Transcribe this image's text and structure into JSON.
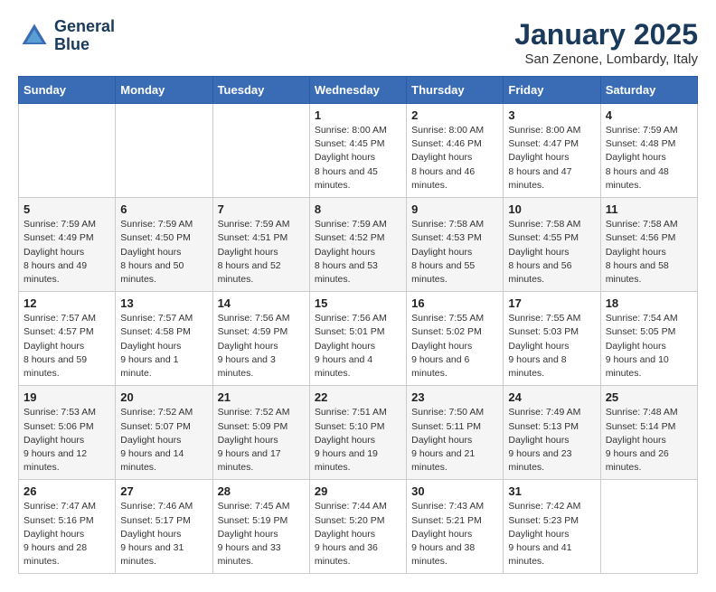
{
  "header": {
    "logo_line1": "General",
    "logo_line2": "Blue",
    "month": "January 2025",
    "location": "San Zenone, Lombardy, Italy"
  },
  "weekdays": [
    "Sunday",
    "Monday",
    "Tuesday",
    "Wednesday",
    "Thursday",
    "Friday",
    "Saturday"
  ],
  "weeks": [
    [
      {
        "day": null
      },
      {
        "day": null
      },
      {
        "day": null
      },
      {
        "day": "1",
        "sunrise": "8:00 AM",
        "sunset": "4:45 PM",
        "daylight": "8 hours and 45 minutes."
      },
      {
        "day": "2",
        "sunrise": "8:00 AM",
        "sunset": "4:46 PM",
        "daylight": "8 hours and 46 minutes."
      },
      {
        "day": "3",
        "sunrise": "8:00 AM",
        "sunset": "4:47 PM",
        "daylight": "8 hours and 47 minutes."
      },
      {
        "day": "4",
        "sunrise": "7:59 AM",
        "sunset": "4:48 PM",
        "daylight": "8 hours and 48 minutes."
      }
    ],
    [
      {
        "day": "5",
        "sunrise": "7:59 AM",
        "sunset": "4:49 PM",
        "daylight": "8 hours and 49 minutes."
      },
      {
        "day": "6",
        "sunrise": "7:59 AM",
        "sunset": "4:50 PM",
        "daylight": "8 hours and 50 minutes."
      },
      {
        "day": "7",
        "sunrise": "7:59 AM",
        "sunset": "4:51 PM",
        "daylight": "8 hours and 52 minutes."
      },
      {
        "day": "8",
        "sunrise": "7:59 AM",
        "sunset": "4:52 PM",
        "daylight": "8 hours and 53 minutes."
      },
      {
        "day": "9",
        "sunrise": "7:58 AM",
        "sunset": "4:53 PM",
        "daylight": "8 hours and 55 minutes."
      },
      {
        "day": "10",
        "sunrise": "7:58 AM",
        "sunset": "4:55 PM",
        "daylight": "8 hours and 56 minutes."
      },
      {
        "day": "11",
        "sunrise": "7:58 AM",
        "sunset": "4:56 PM",
        "daylight": "8 hours and 58 minutes."
      }
    ],
    [
      {
        "day": "12",
        "sunrise": "7:57 AM",
        "sunset": "4:57 PM",
        "daylight": "8 hours and 59 minutes."
      },
      {
        "day": "13",
        "sunrise": "7:57 AM",
        "sunset": "4:58 PM",
        "daylight": "9 hours and 1 minute."
      },
      {
        "day": "14",
        "sunrise": "7:56 AM",
        "sunset": "4:59 PM",
        "daylight": "9 hours and 3 minutes."
      },
      {
        "day": "15",
        "sunrise": "7:56 AM",
        "sunset": "5:01 PM",
        "daylight": "9 hours and 4 minutes."
      },
      {
        "day": "16",
        "sunrise": "7:55 AM",
        "sunset": "5:02 PM",
        "daylight": "9 hours and 6 minutes."
      },
      {
        "day": "17",
        "sunrise": "7:55 AM",
        "sunset": "5:03 PM",
        "daylight": "9 hours and 8 minutes."
      },
      {
        "day": "18",
        "sunrise": "7:54 AM",
        "sunset": "5:05 PM",
        "daylight": "9 hours and 10 minutes."
      }
    ],
    [
      {
        "day": "19",
        "sunrise": "7:53 AM",
        "sunset": "5:06 PM",
        "daylight": "9 hours and 12 minutes."
      },
      {
        "day": "20",
        "sunrise": "7:52 AM",
        "sunset": "5:07 PM",
        "daylight": "9 hours and 14 minutes."
      },
      {
        "day": "21",
        "sunrise": "7:52 AM",
        "sunset": "5:09 PM",
        "daylight": "9 hours and 17 minutes."
      },
      {
        "day": "22",
        "sunrise": "7:51 AM",
        "sunset": "5:10 PM",
        "daylight": "9 hours and 19 minutes."
      },
      {
        "day": "23",
        "sunrise": "7:50 AM",
        "sunset": "5:11 PM",
        "daylight": "9 hours and 21 minutes."
      },
      {
        "day": "24",
        "sunrise": "7:49 AM",
        "sunset": "5:13 PM",
        "daylight": "9 hours and 23 minutes."
      },
      {
        "day": "25",
        "sunrise": "7:48 AM",
        "sunset": "5:14 PM",
        "daylight": "9 hours and 26 minutes."
      }
    ],
    [
      {
        "day": "26",
        "sunrise": "7:47 AM",
        "sunset": "5:16 PM",
        "daylight": "9 hours and 28 minutes."
      },
      {
        "day": "27",
        "sunrise": "7:46 AM",
        "sunset": "5:17 PM",
        "daylight": "9 hours and 31 minutes."
      },
      {
        "day": "28",
        "sunrise": "7:45 AM",
        "sunset": "5:19 PM",
        "daylight": "9 hours and 33 minutes."
      },
      {
        "day": "29",
        "sunrise": "7:44 AM",
        "sunset": "5:20 PM",
        "daylight": "9 hours and 36 minutes."
      },
      {
        "day": "30",
        "sunrise": "7:43 AM",
        "sunset": "5:21 PM",
        "daylight": "9 hours and 38 minutes."
      },
      {
        "day": "31",
        "sunrise": "7:42 AM",
        "sunset": "5:23 PM",
        "daylight": "9 hours and 41 minutes."
      },
      {
        "day": null
      }
    ]
  ]
}
